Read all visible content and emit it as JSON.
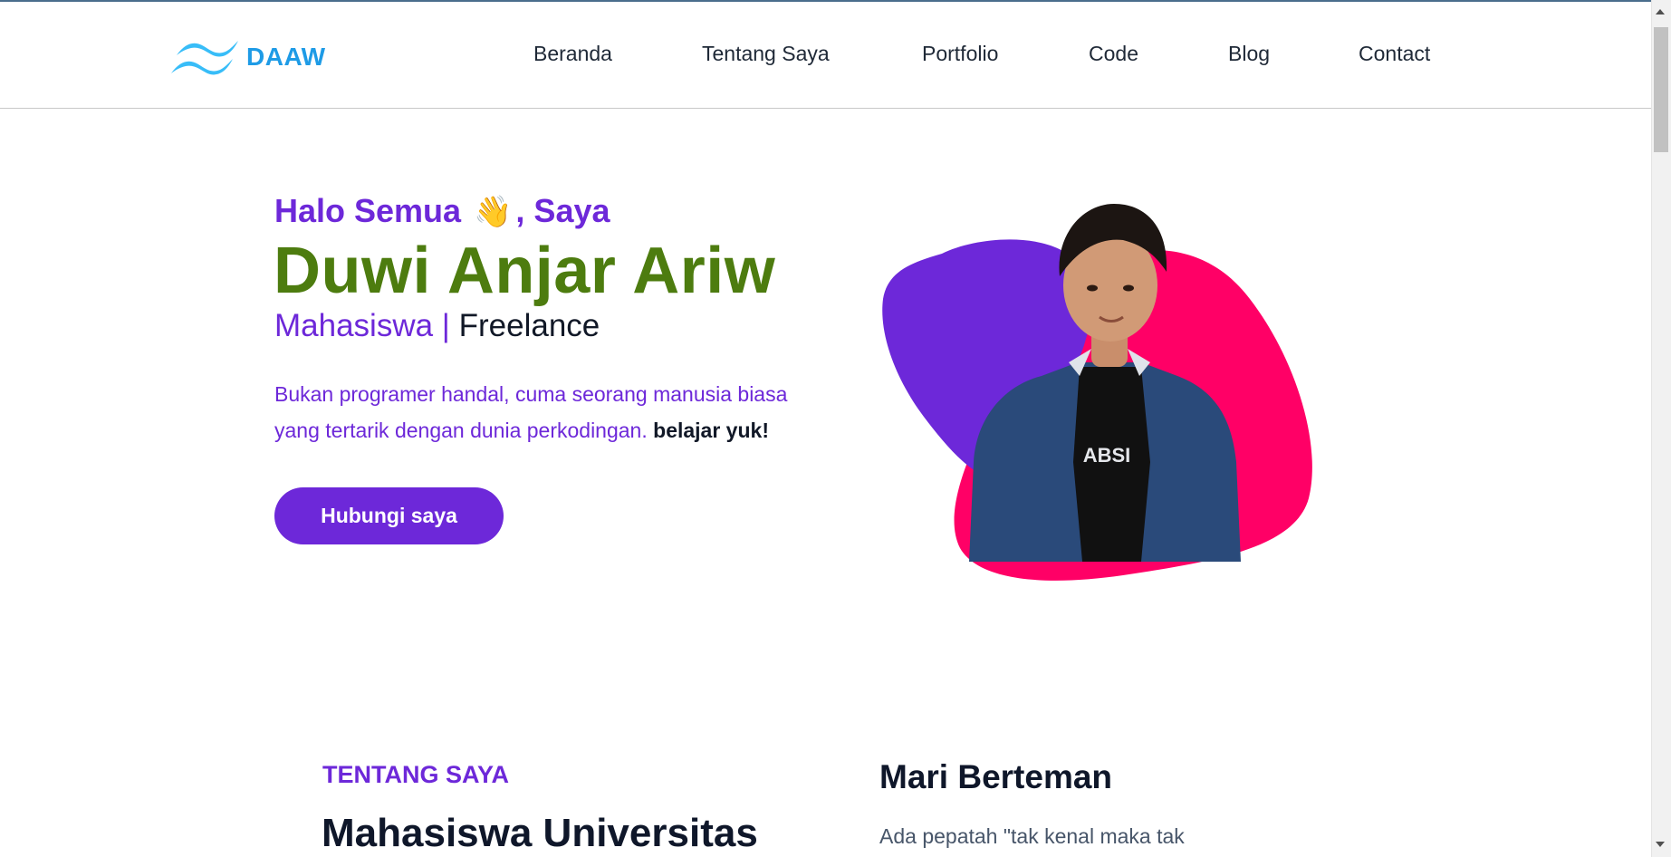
{
  "brand": {
    "name": "DAAW",
    "logo_icon": "wave-logo-icon",
    "color": "#1e9be6"
  },
  "nav": {
    "items": [
      {
        "label": "Beranda"
      },
      {
        "label": "Tentang Saya"
      },
      {
        "label": "Portfolio"
      },
      {
        "label": "Code"
      },
      {
        "label": "Blog"
      },
      {
        "label": "Contact"
      }
    ]
  },
  "hero": {
    "greeting_a": "Halo Semua",
    "wave_emoji": "👋",
    "greeting_b": ", Saya",
    "name": "Duwi Anjar Ariw",
    "role_a": "Mahasiswa |",
    "role_b": "Freelance",
    "desc_line1": "Bukan programer handal, cuma seorang manusia biasa",
    "desc_line2": "yang tertarik dengan dunia perkodingan.",
    "desc_bold": "belajar yuk!",
    "cta_label": "Hubungi saya",
    "art_icon": "profile-photo-blob"
  },
  "about": {
    "tag": "TENTANG SAYA",
    "title": "Mahasiswa Universitas",
    "friend_title": "Mari Berteman",
    "friend_text": "Ada pepatah \"tak kenal maka tak"
  },
  "colors": {
    "primary": "#6d28d9",
    "name_green": "#4d7c0f",
    "blob_pink": "#ff0066",
    "blob_purple": "#6d28d9"
  }
}
